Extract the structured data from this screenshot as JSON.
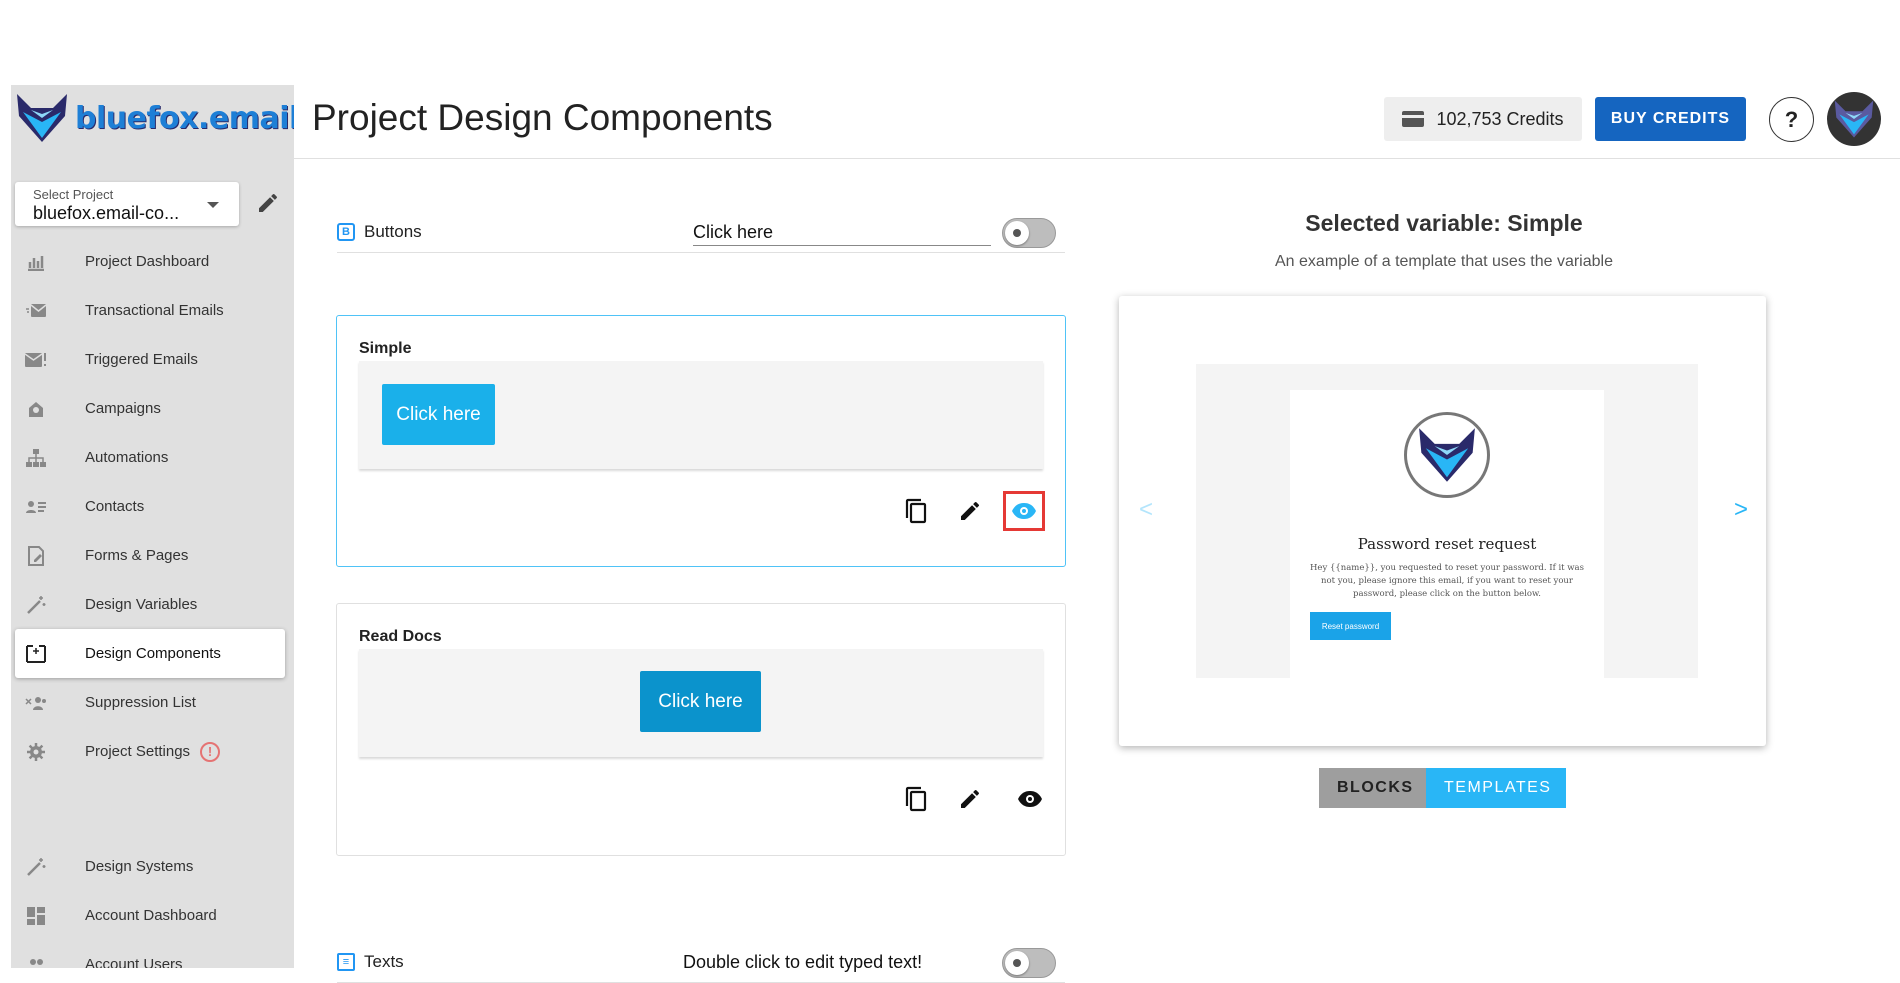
{
  "brand": {
    "logo_text": "bluefox.email"
  },
  "project_select": {
    "label": "Select Project",
    "value": "bluefox.email-co..."
  },
  "nav": [
    {
      "id": "project-dashboard",
      "label": "Project Dashboard",
      "icon": "chart-icon"
    },
    {
      "id": "transactional-emails",
      "label": "Transactional Emails",
      "icon": "mail-send-icon"
    },
    {
      "id": "triggered-emails",
      "label": "Triggered Emails",
      "icon": "mail-alert-icon"
    },
    {
      "id": "campaigns",
      "label": "Campaigns",
      "icon": "campaign-icon"
    },
    {
      "id": "automations",
      "label": "Automations",
      "icon": "sitemap-icon"
    },
    {
      "id": "contacts",
      "label": "Contacts",
      "icon": "contacts-icon"
    },
    {
      "id": "forms-pages",
      "label": "Forms & Pages",
      "icon": "form-icon"
    },
    {
      "id": "design-variables",
      "label": "Design Variables",
      "icon": "wand-icon"
    },
    {
      "id": "design-components",
      "label": "Design Components",
      "icon": "component-icon",
      "active": true
    },
    {
      "id": "suppression-list",
      "label": "Suppression List",
      "icon": "user-block-icon"
    },
    {
      "id": "project-settings",
      "label": "Project Settings",
      "icon": "gear-icon",
      "warning": "!"
    }
  ],
  "nav_bottom": [
    {
      "id": "design-systems",
      "label": "Design Systems",
      "icon": "wand-icon"
    },
    {
      "id": "account-dashboard",
      "label": "Account Dashboard",
      "icon": "dashboard-icon"
    },
    {
      "id": "account-users",
      "label": "Account Users",
      "icon": "users-icon"
    }
  ],
  "header": {
    "title": "Project Design Components",
    "credits": "102,753 Credits",
    "buy_label": "BUY CREDITS",
    "help_label": "?"
  },
  "buttons_section": {
    "title": "Buttons",
    "icon_letter": "B",
    "input_value": "Click here",
    "cards": [
      {
        "title": "Simple",
        "button_text": "Click here",
        "button_color": "#1ab0ea"
      },
      {
        "title": "Read Docs",
        "button_text": "Click here",
        "button_color": "#0b93cc"
      }
    ]
  },
  "texts_section": {
    "title": "Texts",
    "input_value": "Double click to edit typed text!"
  },
  "preview": {
    "title": "Selected variable: Simple",
    "subtitle": "An example of a template that uses the variable",
    "template_heading": "Password reset request",
    "template_body": "Hey {{name}}, you requested to reset your password. If it was not you, please ignore this email, if you want to reset your password, please click on the button below.",
    "template_button": "Reset password",
    "prev_arrow": "<",
    "next_arrow": ">",
    "tabs": {
      "blocks": "BLOCKS",
      "templates": "TEMPLATES"
    }
  },
  "colors": {
    "accent": "#29b6f6",
    "primary": "#1565c0",
    "highlight": "#e53935"
  }
}
